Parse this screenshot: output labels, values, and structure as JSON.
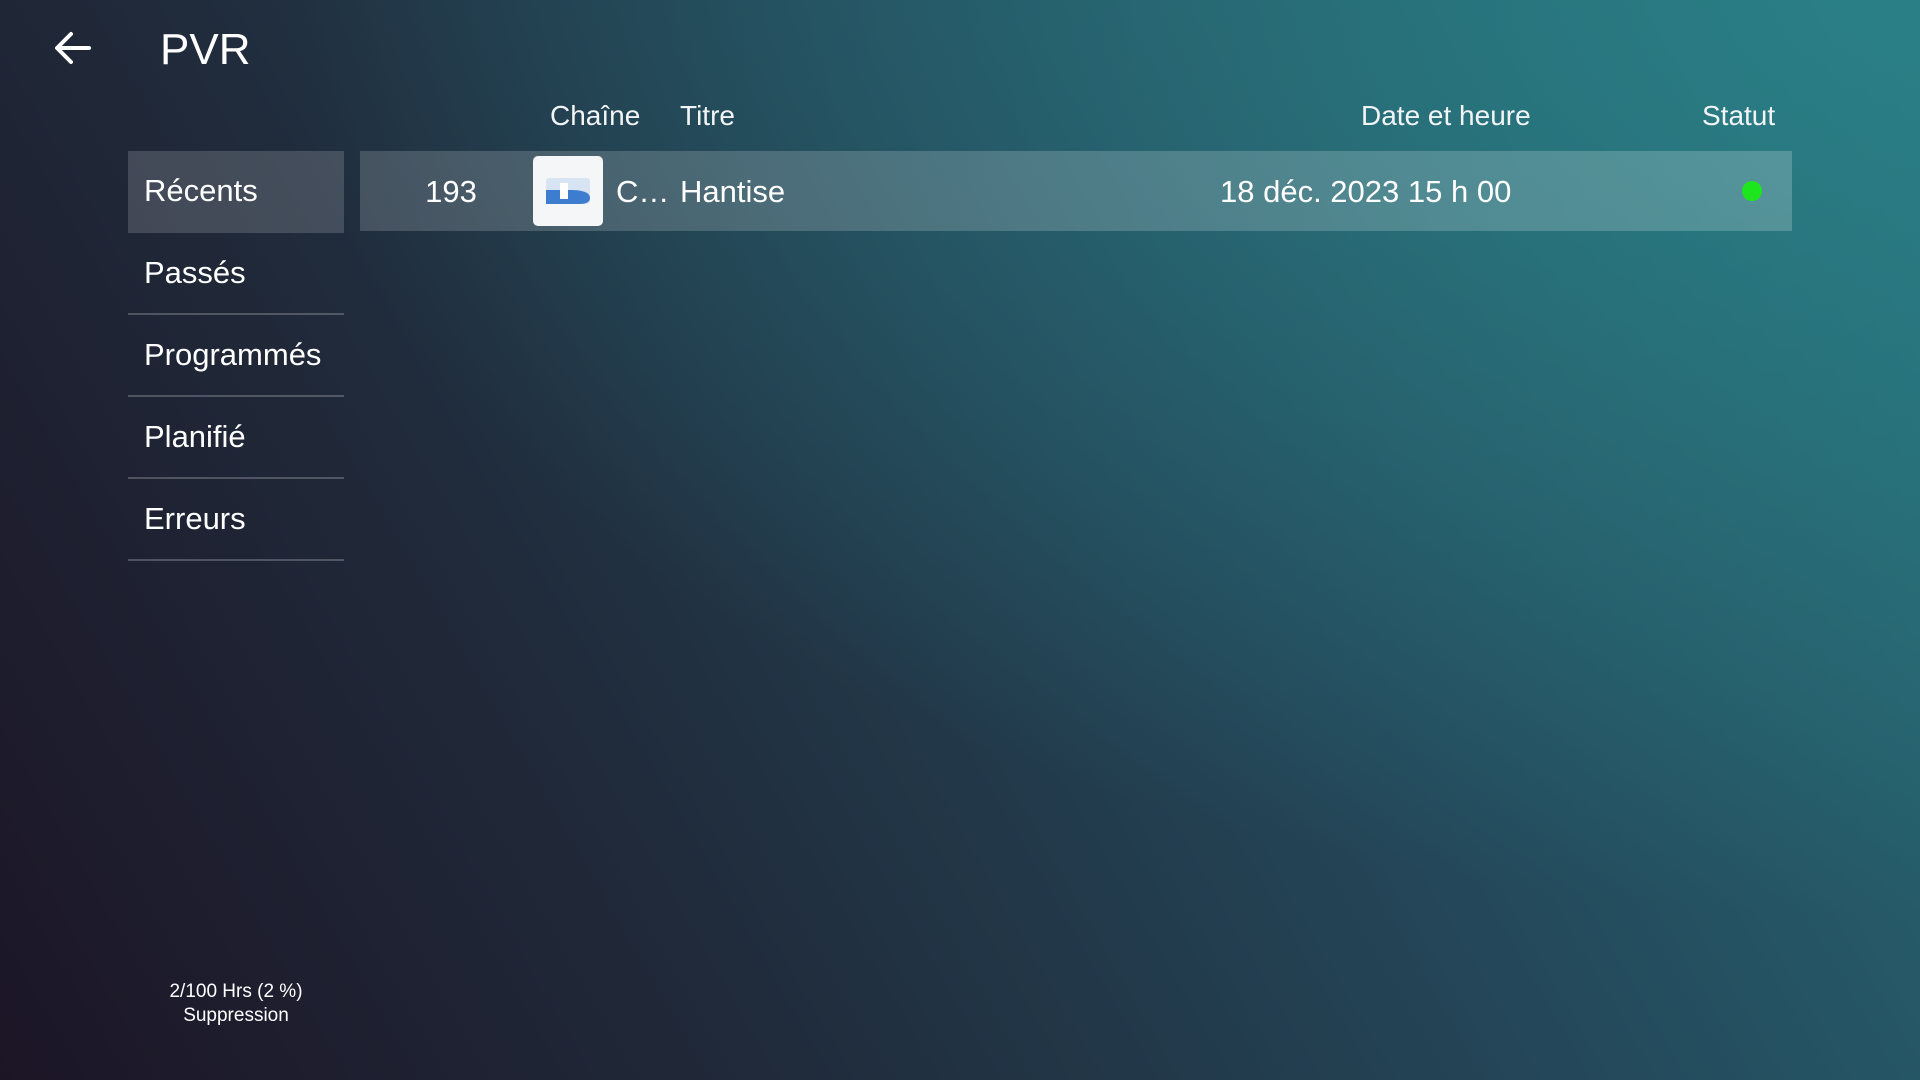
{
  "app": {
    "title": "PVR"
  },
  "table": {
    "headers": {
      "channel": "Chaîne",
      "title": "Titre",
      "date": "Date et heure",
      "status": "Statut"
    },
    "rows": [
      {
        "number": "193",
        "channel": "Ca…",
        "title": "Hantise",
        "datetime": "18 déc. 2023 15 h 00",
        "status_color": "#1ee61e"
      }
    ]
  },
  "sidebar": {
    "items": [
      {
        "label": "Récents",
        "selected": true
      },
      {
        "label": "Passés",
        "selected": false
      },
      {
        "label": "Programmés",
        "selected": false
      },
      {
        "label": "Planifié",
        "selected": false
      },
      {
        "label": "Erreurs",
        "selected": false
      }
    ]
  },
  "storage": {
    "usage": "2/100 Hrs (2 %)",
    "action": "Suppression"
  },
  "icons": {
    "back": "arrow-left-icon",
    "channel_logo": "channel-d-logo-icon"
  },
  "colors": {
    "status_active": "#1ee61e",
    "logo_blue": "#3d7dd0"
  }
}
